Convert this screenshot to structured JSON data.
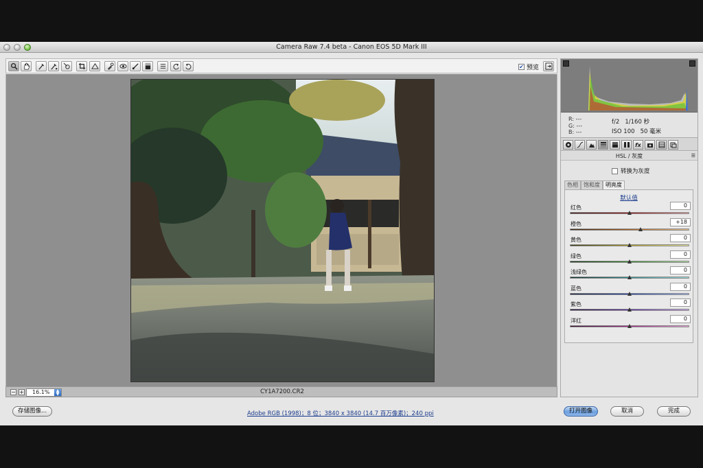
{
  "window": {
    "title": "Camera Raw 7.4 beta -  Canon EOS 5D Mark III"
  },
  "toolbar": {
    "tools": [
      "zoom-icon",
      "hand-icon",
      "white-balance-icon",
      "color-sampler-icon",
      "target-adjust-icon",
      "crop-icon",
      "straighten-icon",
      "spot-removal-icon",
      "red-eye-icon",
      "adjustment-brush-icon",
      "graduated-filter-icon",
      "preferences-icon",
      "rotate-left-icon",
      "rotate-right-icon"
    ],
    "preview_label": "预览",
    "preview_checked": true
  },
  "status": {
    "zoom": "16.1%",
    "filename": "CY1A7200.CR2"
  },
  "camera_info": {
    "r": "R:",
    "g": "G:",
    "b": "B:",
    "r_val": "---",
    "g_val": "---",
    "b_val": "---",
    "aperture": "f/2",
    "shutter": "1/160 秒",
    "iso": "ISO 100",
    "focal": "50 毫米"
  },
  "panel": {
    "title": "HSL / 灰度",
    "grayscale_label": "转换为灰度",
    "subtabs": [
      "色相",
      "饱和度",
      "明亮度"
    ],
    "active_subtab": 2,
    "default_link": "默认值",
    "sliders": [
      {
        "label": "红色",
        "value": "0",
        "position": 0.5,
        "gradient": "linear-gradient(90deg,#3a1010,#a01818,#e0a0a0)"
      },
      {
        "label": "橙色",
        "value": "+18",
        "position": 0.59,
        "gradient": "linear-gradient(90deg,#3a2410,#b0601c,#f0c890)"
      },
      {
        "label": "黄色",
        "value": "0",
        "position": 0.5,
        "gradient": "linear-gradient(90deg,#3a3810,#b0a020,#f0ec9a)"
      },
      {
        "label": "绿色",
        "value": "0",
        "position": 0.5,
        "gradient": "linear-gradient(90deg,#12300f,#3a9030,#b0e0a0)"
      },
      {
        "label": "浅绿色",
        "value": "0",
        "position": 0.5,
        "gradient": "linear-gradient(90deg,#103030,#309090,#a0e0e0)"
      },
      {
        "label": "蓝色",
        "value": "0",
        "position": 0.5,
        "gradient": "linear-gradient(90deg,#101838,#2448b0,#a0b8f0)"
      },
      {
        "label": "紫色",
        "value": "0",
        "position": 0.5,
        "gradient": "linear-gradient(90deg,#201038,#6030a8,#c8a8ec)"
      },
      {
        "label": "洋红",
        "value": "0",
        "position": 0.5,
        "gradient": "linear-gradient(90deg,#381030,#a82890,#eca8dc)"
      }
    ]
  },
  "bottom": {
    "save_label": "存储图像...",
    "workflow_link": "Adobe RGB (1998)；8 位；3840 x 3840 (14.7 百万像素)；240 ppi",
    "open_label": "打开图像",
    "cancel_label": "取消",
    "done_label": "完成"
  }
}
